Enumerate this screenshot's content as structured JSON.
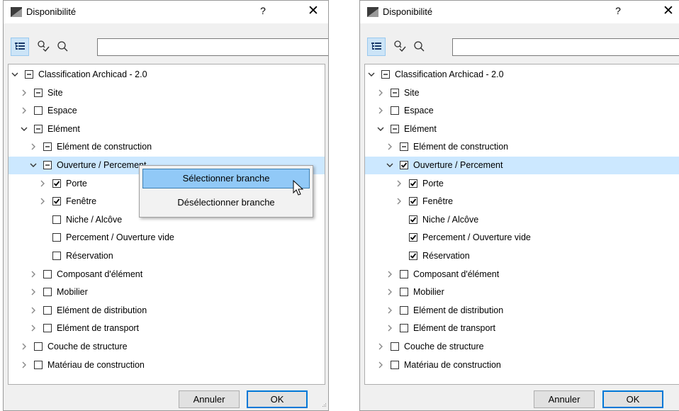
{
  "dialog_title": "Disponibilité",
  "help_label": "?",
  "close_label": "✕",
  "search": {
    "value": "",
    "placeholder": ""
  },
  "buttons": {
    "cancel": "Annuler",
    "ok": "OK"
  },
  "icons": {
    "app": "archicad-icon",
    "tree_view": "tree-view-icon",
    "filter": "filter-icon",
    "search": "search-icon"
  },
  "colors": {
    "selection": "#cce8ff",
    "menu_highlight": "#91c9f7",
    "ok_border": "#0078d7"
  },
  "tree_left": [
    {
      "label": "Classification Archicad - 2.0",
      "depth": 0,
      "expander": "open",
      "check": "partial",
      "selected": false
    },
    {
      "label": "Site",
      "depth": 1,
      "expander": "closed",
      "check": "partial",
      "selected": false
    },
    {
      "label": "Espace",
      "depth": 1,
      "expander": "closed",
      "check": "none",
      "selected": false
    },
    {
      "label": "Elément",
      "depth": 1,
      "expander": "open",
      "check": "partial",
      "selected": false
    },
    {
      "label": "Elément de construction",
      "depth": 2,
      "expander": "closed",
      "check": "partial",
      "selected": false
    },
    {
      "label": "Ouverture / Percement",
      "depth": 2,
      "expander": "open",
      "check": "partial",
      "selected": true
    },
    {
      "label": "Porte",
      "depth": 3,
      "expander": "closed",
      "check": "checked",
      "selected": false
    },
    {
      "label": "Fenêtre",
      "depth": 3,
      "expander": "closed",
      "check": "checked",
      "selected": false
    },
    {
      "label": "Niche / Alcôve",
      "depth": 3,
      "expander": "none",
      "check": "none",
      "selected": false
    },
    {
      "label": "Percement / Ouverture vide",
      "depth": 3,
      "expander": "none",
      "check": "none",
      "selected": false
    },
    {
      "label": "Réservation",
      "depth": 3,
      "expander": "none",
      "check": "none",
      "selected": false
    },
    {
      "label": "Composant d'élément",
      "depth": 2,
      "expander": "closed",
      "check": "none",
      "selected": false
    },
    {
      "label": "Mobilier",
      "depth": 2,
      "expander": "closed",
      "check": "none",
      "selected": false
    },
    {
      "label": "Elément de distribution",
      "depth": 2,
      "expander": "closed",
      "check": "none",
      "selected": false
    },
    {
      "label": "Elément de transport",
      "depth": 2,
      "expander": "closed",
      "check": "none",
      "selected": false
    },
    {
      "label": "Couche de structure",
      "depth": 1,
      "expander": "closed",
      "check": "none",
      "selected": false
    },
    {
      "label": "Matériau de construction",
      "depth": 1,
      "expander": "closed",
      "check": "none",
      "selected": false
    }
  ],
  "tree_right": [
    {
      "label": "Classification Archicad - 2.0",
      "depth": 0,
      "expander": "open",
      "check": "partial",
      "selected": false
    },
    {
      "label": "Site",
      "depth": 1,
      "expander": "closed",
      "check": "partial",
      "selected": false
    },
    {
      "label": "Espace",
      "depth": 1,
      "expander": "closed",
      "check": "none",
      "selected": false
    },
    {
      "label": "Elément",
      "depth": 1,
      "expander": "open",
      "check": "partial",
      "selected": false
    },
    {
      "label": "Elément de construction",
      "depth": 2,
      "expander": "closed",
      "check": "partial",
      "selected": false
    },
    {
      "label": "Ouverture / Percement",
      "depth": 2,
      "expander": "open",
      "check": "checked",
      "selected": true
    },
    {
      "label": "Porte",
      "depth": 3,
      "expander": "closed",
      "check": "checked",
      "selected": false
    },
    {
      "label": "Fenêtre",
      "depth": 3,
      "expander": "closed",
      "check": "checked",
      "selected": false
    },
    {
      "label": "Niche / Alcôve",
      "depth": 3,
      "expander": "none",
      "check": "checked",
      "selected": false
    },
    {
      "label": "Percement / Ouverture vide",
      "depth": 3,
      "expander": "none",
      "check": "checked",
      "selected": false
    },
    {
      "label": "Réservation",
      "depth": 3,
      "expander": "none",
      "check": "checked",
      "selected": false
    },
    {
      "label": "Composant d'élément",
      "depth": 2,
      "expander": "closed",
      "check": "none",
      "selected": false
    },
    {
      "label": "Mobilier",
      "depth": 2,
      "expander": "closed",
      "check": "none",
      "selected": false
    },
    {
      "label": "Elément de distribution",
      "depth": 2,
      "expander": "closed",
      "check": "none",
      "selected": false
    },
    {
      "label": "Elément de transport",
      "depth": 2,
      "expander": "closed",
      "check": "none",
      "selected": false
    },
    {
      "label": "Couche de structure",
      "depth": 1,
      "expander": "closed",
      "check": "none",
      "selected": false
    },
    {
      "label": "Matériau de construction",
      "depth": 1,
      "expander": "closed",
      "check": "none",
      "selected": false
    }
  ],
  "context_menu": {
    "items": [
      {
        "label": "Sélectionner branche",
        "highlighted": true
      },
      {
        "label": "Désélectionner branche",
        "highlighted": false
      }
    ]
  }
}
